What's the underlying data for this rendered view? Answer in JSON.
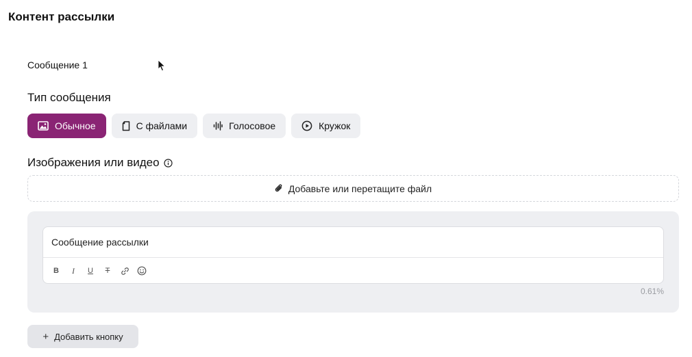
{
  "section": {
    "title": "Контент рассылки"
  },
  "message": {
    "label": "Сообщение 1"
  },
  "message_type": {
    "title": "Тип сообщения",
    "options": [
      {
        "label": "Обычное",
        "icon": "image-icon",
        "active": true
      },
      {
        "label": "С файлами",
        "icon": "file-icon",
        "active": false
      },
      {
        "label": "Голосовое",
        "icon": "voice-wave-icon",
        "active": false
      },
      {
        "label": "Кружок",
        "icon": "play-circle-icon",
        "active": false
      }
    ]
  },
  "media": {
    "title": "Изображения или видео",
    "dropzone_label": "Добавьте или перетащите файл"
  },
  "editor": {
    "placeholder": "Сообщение рассылки",
    "toolbar": [
      "bold",
      "italic",
      "underline",
      "strikethrough",
      "link",
      "emoji"
    ],
    "toolbar_glyphs": {
      "bold": "B",
      "italic": "I",
      "underline": "U",
      "strikethrough": "T"
    },
    "usage_percent": "0.61%"
  },
  "add_button": {
    "label": "Добавить кнопку"
  },
  "colors": {
    "accent": "#8a2474",
    "chip_bg": "#eeeff2",
    "panel_bg": "#eeeff2",
    "muted_text": "#999ba0"
  }
}
